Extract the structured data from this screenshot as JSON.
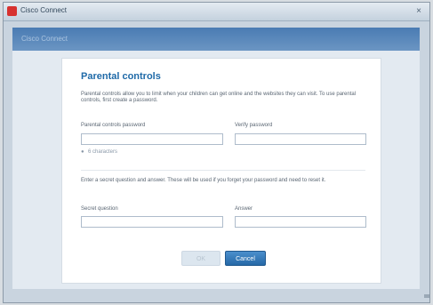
{
  "window": {
    "title": "Cisco Connect",
    "close_glyph": "×"
  },
  "banner": {
    "label": "Cisco Connect"
  },
  "form": {
    "title": "Parental controls",
    "intro": "Parental controls allow you to limit when your children can get online and the websites they can visit. To use parental controls, first create a password.",
    "password_label": "Parental controls password",
    "verify_label": "Verify password",
    "password_value": "",
    "verify_value": "",
    "strength_text": "6 characters",
    "note": "Enter a secret question and answer. These will be used if you forget your password and need to reset it.",
    "question_label": "Secret question",
    "answer_label": "Answer",
    "question_value": "",
    "answer_value": "",
    "ok_label": "OK",
    "cancel_label": "Cancel"
  },
  "colors": {
    "accent": "#1f6aa8",
    "banner": "#4a7bb3",
    "app_icon": "#d7322f"
  },
  "icons": {
    "app": "cisco-app-icon",
    "close": "close-icon",
    "strength": "strength-indicator-icon"
  }
}
